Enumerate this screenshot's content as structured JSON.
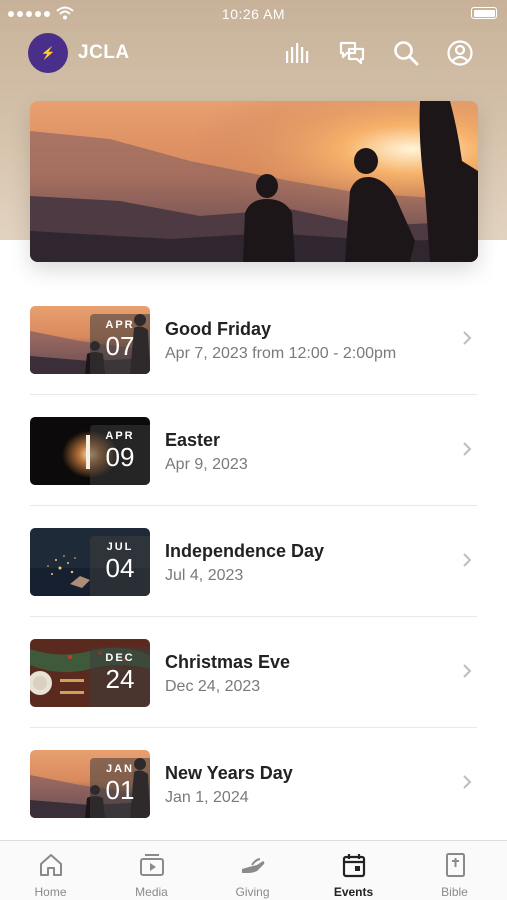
{
  "status_bar": {
    "time": "10:26 AM"
  },
  "app": {
    "name": "JCLA"
  },
  "events": [
    {
      "month": "APR",
      "day": "07",
      "title": "Good Friday",
      "date": "Apr 7, 2023 from 12:00 - 2:00pm"
    },
    {
      "month": "APR",
      "day": "09",
      "title": "Easter",
      "date": "Apr 9, 2023"
    },
    {
      "month": "JUL",
      "day": "04",
      "title": "Independence Day",
      "date": "Jul 4, 2023"
    },
    {
      "month": "DEC",
      "day": "24",
      "title": "Christmas Eve",
      "date": "Dec 24, 2023"
    },
    {
      "month": "JAN",
      "day": "01",
      "title": "New Years Day",
      "date": "Jan 1, 2024"
    }
  ],
  "tabs": [
    {
      "label": "Home",
      "icon": "home-icon"
    },
    {
      "label": "Media",
      "icon": "media-icon"
    },
    {
      "label": "Giving",
      "icon": "giving-icon"
    },
    {
      "label": "Events",
      "icon": "calendar-icon",
      "active": true
    },
    {
      "label": "Bible",
      "icon": "bible-icon"
    }
  ],
  "colors": {
    "header": "#c7b199",
    "logo": "#4a2f8a",
    "active_tab": "#222222",
    "inactive_tab": "#8a8a8a"
  }
}
